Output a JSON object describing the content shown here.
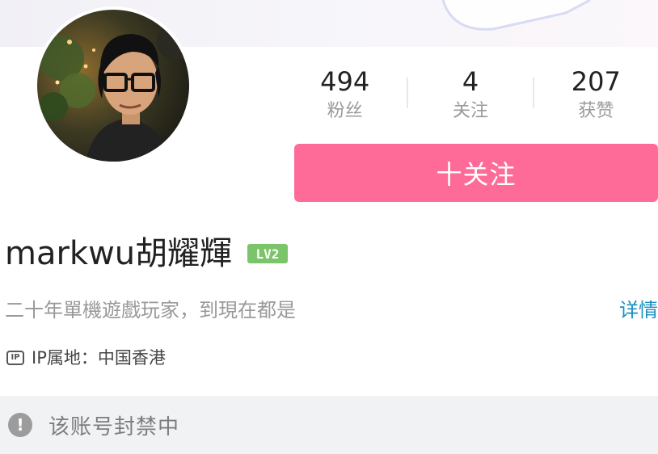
{
  "profile": {
    "username": "markwu胡耀輝",
    "level": "LV2",
    "bio": "二十年單機遊戲玩家，到現在都是",
    "detail_link": "详情",
    "ip_badge": "IP",
    "ip_location": "IP属地：中国香港"
  },
  "stats": [
    {
      "value": "494",
      "label": "粉丝"
    },
    {
      "value": "4",
      "label": "关注"
    },
    {
      "value": "207",
      "label": "获赞"
    }
  ],
  "follow_button": {
    "label": "十关注"
  },
  "notice": {
    "icon": "exclamation-icon",
    "text": "该账号封禁中"
  },
  "colors": {
    "follow_button": "#fe6b98",
    "level_badge": "#7cc46a",
    "detail_link": "#1a8fbf",
    "notice_background": "#f1f2f4"
  }
}
